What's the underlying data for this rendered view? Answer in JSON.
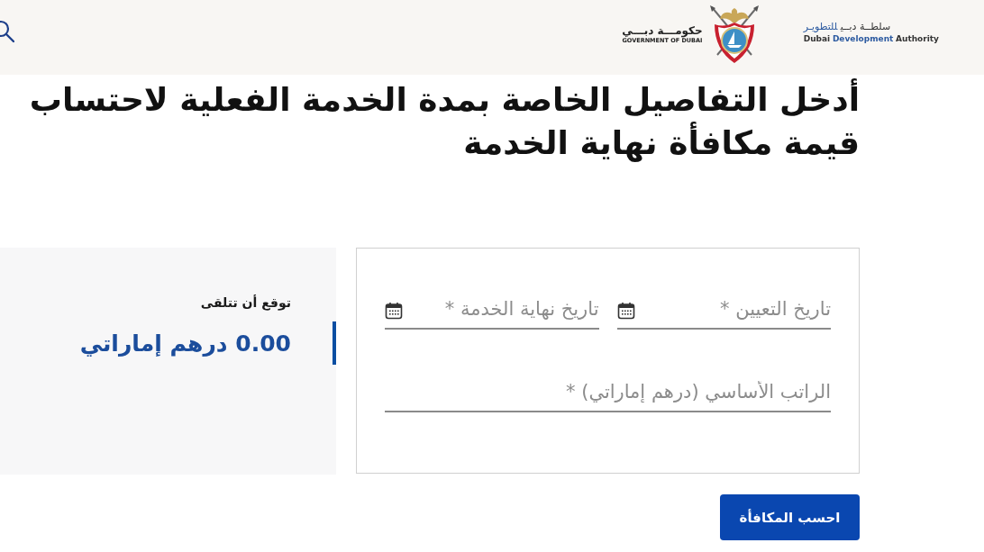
{
  "header": {
    "government_logo": {
      "name_ar": "حكومـــة دبـــي",
      "name_en": "GOVERNMENT OF DUBAI"
    },
    "authority_logo": {
      "name_ar": {
        "start": "سلطــة دبــي",
        "highlighted": "للتطويـر"
      },
      "name_en": {
        "start": "Dubai",
        "highlighted": "Development",
        "end": "Authority"
      }
    }
  },
  "title": "أدخل التفاصيل الخاصة بمدة الخدمة الفعلية لاحتساب قيمة مكافأة نهاية الخدمة",
  "form": {
    "fields": [
      {
        "kind": "date",
        "placeholder": "تاريخ التعيين *"
      },
      {
        "kind": "date",
        "placeholder": "تاريخ نهاية الخدمة *"
      },
      {
        "kind": "number",
        "placeholder": "الراتب الأساسي (درهم إماراتي) *"
      }
    ]
  },
  "result": {
    "label": "توقع أن تتلقى",
    "value": "0.00 درهم إماراتي"
  },
  "submit_button": "احسب المكافأة"
}
